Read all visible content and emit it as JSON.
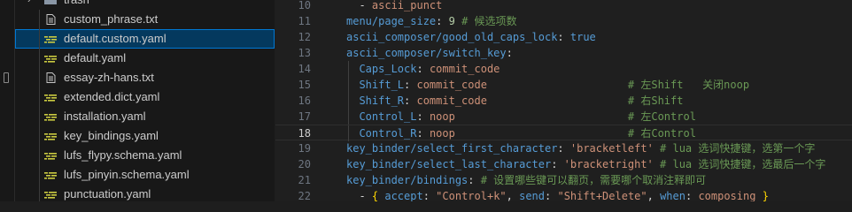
{
  "explorer": {
    "folder": "trash",
    "files": [
      {
        "name": "custom_phrase.txt",
        "type": "txt",
        "selected": false
      },
      {
        "name": "default.custom.yaml",
        "type": "yaml",
        "selected": true
      },
      {
        "name": "default.yaml",
        "type": "yaml",
        "selected": false
      },
      {
        "name": "essay-zh-hans.txt",
        "type": "txt",
        "selected": false
      },
      {
        "name": "extended.dict.yaml",
        "type": "yaml",
        "selected": false
      },
      {
        "name": "installation.yaml",
        "type": "yaml",
        "selected": false
      },
      {
        "name": "key_bindings.yaml",
        "type": "yaml",
        "selected": false
      },
      {
        "name": "lufs_flypy.schema.yaml",
        "type": "yaml",
        "selected": false
      },
      {
        "name": "lufs_pinyin.schema.yaml",
        "type": "yaml",
        "selected": false
      },
      {
        "name": "punctuation.yaml",
        "type": "yaml",
        "selected": false
      }
    ]
  },
  "editor": {
    "current_line": "18",
    "lines": [
      {
        "num": "10",
        "t": [
          [
            "  ",
            "p"
          ],
          [
            "- ",
            "p"
          ],
          [
            "ascii_punct",
            "s"
          ]
        ]
      },
      {
        "num": "11",
        "t": [
          [
            "menu/page_size",
            "k"
          ],
          [
            ": ",
            "p"
          ],
          [
            "9",
            "n"
          ],
          [
            " # 候选项数",
            "c"
          ]
        ]
      },
      {
        "num": "12",
        "t": [
          [
            "ascii_composer/good_old_caps_lock",
            "k"
          ],
          [
            ": ",
            "p"
          ],
          [
            "true",
            "b"
          ]
        ]
      },
      {
        "num": "13",
        "t": [
          [
            "ascii_composer/switch_key",
            "k"
          ],
          [
            ":",
            "p"
          ]
        ]
      },
      {
        "num": "14",
        "guide": true,
        "t": [
          [
            "  ",
            "p"
          ],
          [
            "Caps_Lock",
            "k"
          ],
          [
            ": ",
            "p"
          ],
          [
            "commit_code",
            "s"
          ]
        ]
      },
      {
        "num": "15",
        "guide": true,
        "t": [
          [
            "  ",
            "p"
          ],
          [
            "Shift_L",
            "k"
          ],
          [
            ": ",
            "p"
          ],
          [
            "commit_code",
            "s"
          ],
          [
            "                      # 左Shift   关闭noop",
            "c"
          ]
        ]
      },
      {
        "num": "16",
        "guide": true,
        "t": [
          [
            "  ",
            "p"
          ],
          [
            "Shift_R",
            "k"
          ],
          [
            ": ",
            "p"
          ],
          [
            "commit_code",
            "s"
          ],
          [
            "                      # 右Shift",
            "c"
          ]
        ]
      },
      {
        "num": "17",
        "guide": true,
        "t": [
          [
            "  ",
            "p"
          ],
          [
            "Control_L",
            "k"
          ],
          [
            ": ",
            "p"
          ],
          [
            "noop",
            "s"
          ],
          [
            "                           # 左Control",
            "c"
          ]
        ]
      },
      {
        "num": "18",
        "guide": true,
        "t": [
          [
            "  ",
            "p"
          ],
          [
            "Control_R",
            "k"
          ],
          [
            ": ",
            "p"
          ],
          [
            "noop",
            "s"
          ],
          [
            "                           # 右Control",
            "c"
          ]
        ]
      },
      {
        "num": "19",
        "t": [
          [
            "key_binder/select_first_character",
            "k"
          ],
          [
            ": ",
            "p"
          ],
          [
            "'bracketleft'",
            "s"
          ],
          [
            " # lua 选词快捷键，选第一个字",
            "c"
          ]
        ]
      },
      {
        "num": "20",
        "t": [
          [
            "key_binder/select_last_character",
            "k"
          ],
          [
            ": ",
            "p"
          ],
          [
            "'bracketright'",
            "s"
          ],
          [
            " # lua 选词快捷键，选最后一个字",
            "c"
          ]
        ]
      },
      {
        "num": "21",
        "t": [
          [
            "key_binder/bindings",
            "k"
          ],
          [
            ": ",
            "p"
          ],
          [
            "# 设置哪些键可以翻页，需要哪个取消注释即可",
            "c"
          ]
        ]
      },
      {
        "num": "22",
        "t": [
          [
            "  ",
            "p"
          ],
          [
            "- ",
            "p"
          ],
          [
            "{ ",
            "y"
          ],
          [
            "accept",
            "k"
          ],
          [
            ": ",
            "p"
          ],
          [
            "\"Control+k\"",
            "s"
          ],
          [
            ", ",
            "p"
          ],
          [
            "send",
            "k"
          ],
          [
            ": ",
            "p"
          ],
          [
            "\"Shift+Delete\"",
            "s"
          ],
          [
            ", ",
            "p"
          ],
          [
            "when",
            "k"
          ],
          [
            ": ",
            "p"
          ],
          [
            "composing",
            "s"
          ],
          [
            " }",
            "y"
          ]
        ]
      }
    ]
  }
}
